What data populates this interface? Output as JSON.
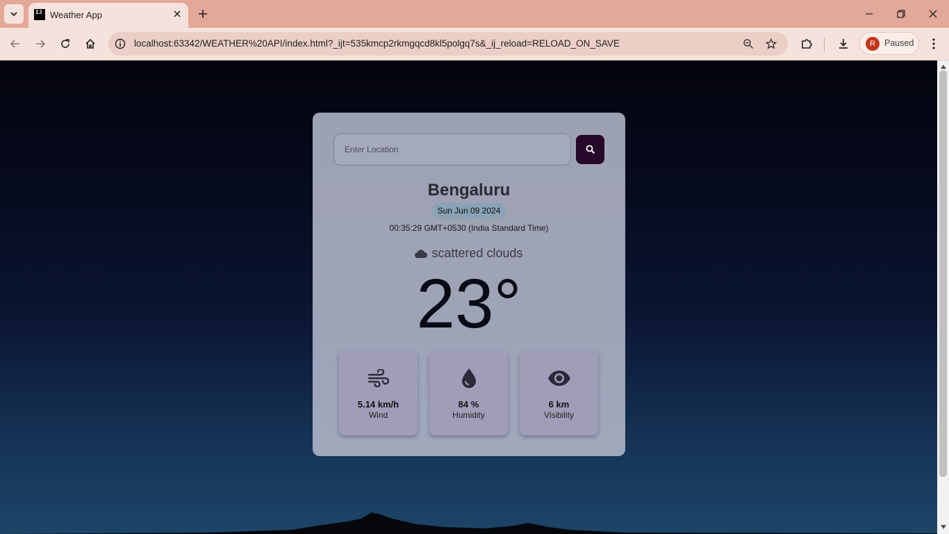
{
  "browser": {
    "tab": {
      "title": "Weather App",
      "favicon_text": "IJ"
    },
    "url": "localhost:63342/WEATHER%20API/index.html?_ijt=535kmcp2rkmgqcd8kl5polgq7s&_ij_reload=RELOAD_ON_SAVE",
    "profile": {
      "initial": "R",
      "status": "Paused"
    },
    "icons": {
      "tab_dropdown": "chevron-down-icon",
      "tab_close": "close-icon",
      "new_tab": "plus-icon",
      "minimize": "minimize-icon",
      "restore": "restore-icon",
      "close": "close-icon",
      "back": "back-arrow-icon",
      "forward": "forward-arrow-icon",
      "reload": "reload-icon",
      "home": "home-icon",
      "site_info": "info-icon",
      "zoom": "zoom-icon",
      "bookmark": "star-icon",
      "extensions": "puzzle-icon",
      "downloads": "download-icon",
      "menu": "kebab-menu-icon"
    }
  },
  "weather": {
    "search": {
      "placeholder": "Enter Location",
      "value": "",
      "icon": "search-icon"
    },
    "city": "Bengaluru",
    "date": "Sun Jun 09 2024",
    "time": "00:35:29 GMT+0530 (India Standard Time)",
    "condition": {
      "text": "scattered clouds",
      "icon": "cloud-icon"
    },
    "temperature": "23°",
    "stats": [
      {
        "value": "5.14 km/h",
        "label": "Wind",
        "icon": "wind-icon"
      },
      {
        "value": "84 %",
        "label": "Humidity",
        "icon": "water-drop-icon"
      },
      {
        "value": "6 km",
        "label": "Visibility",
        "icon": "eye-icon"
      }
    ]
  },
  "colors": {
    "tabbar": "#e3a899",
    "toolbar": "#f6e2dc",
    "search_button": "#26082b",
    "stat_card": "#a09db8",
    "date_badge": "#8aa2b5",
    "avatar": "#c5351e"
  }
}
